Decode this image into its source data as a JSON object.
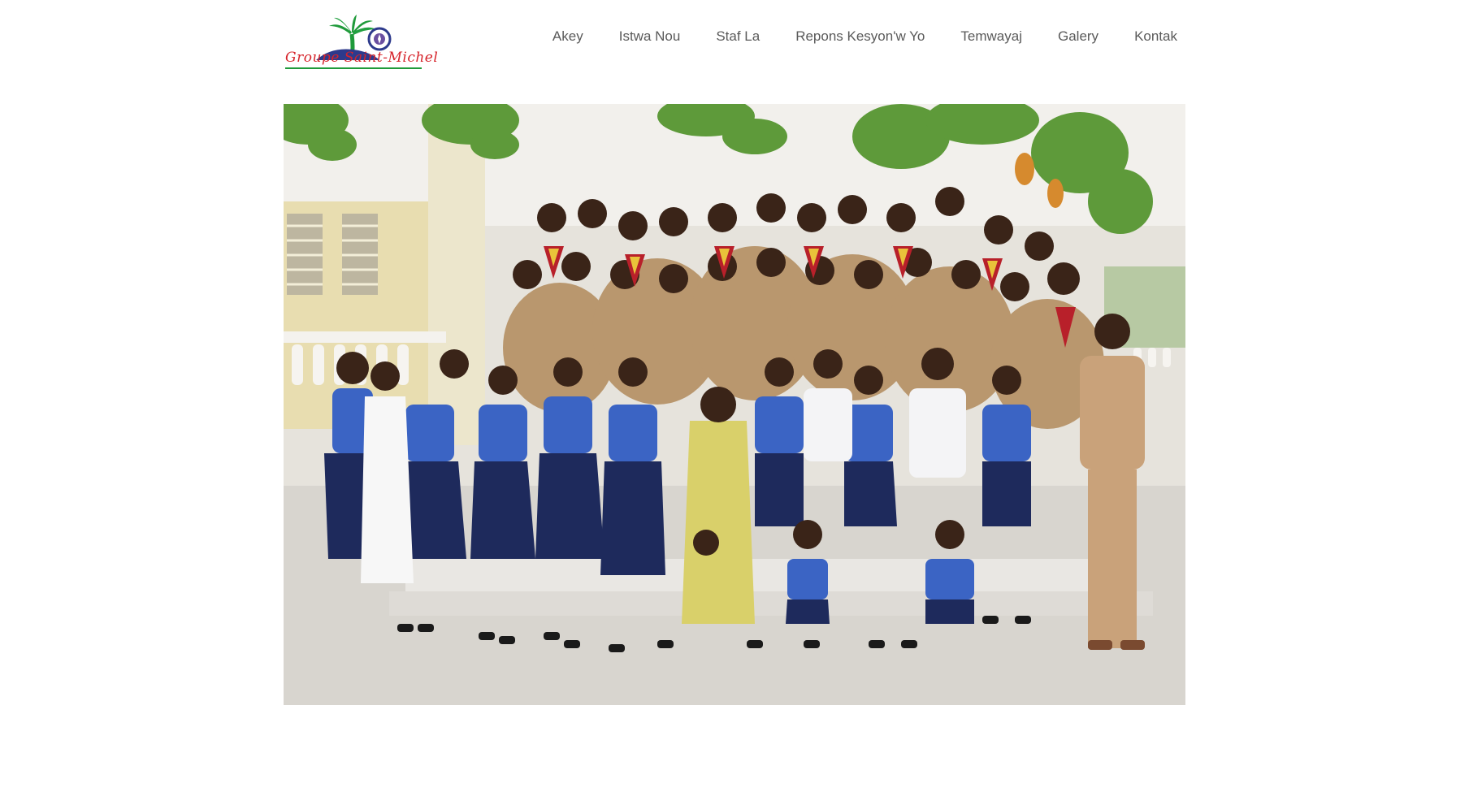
{
  "site": {
    "logo_text": "Groupe Saint-Michel",
    "logo_icon": "palm-tree-scout-emblem"
  },
  "nav": {
    "items": [
      {
        "label": "Akey"
      },
      {
        "label": "Istwa Nou"
      },
      {
        "label": "Staf La"
      },
      {
        "label": "Repons Kesyon'w Yo"
      },
      {
        "label": "Temwayaj"
      },
      {
        "label": "Galery"
      },
      {
        "label": "Kontak"
      }
    ]
  },
  "colors": {
    "nav_text": "#5a5a5a",
    "logo_red": "#d6232a",
    "logo_green": "#1f9a3a",
    "logo_blue": "#2d3a8c"
  }
}
